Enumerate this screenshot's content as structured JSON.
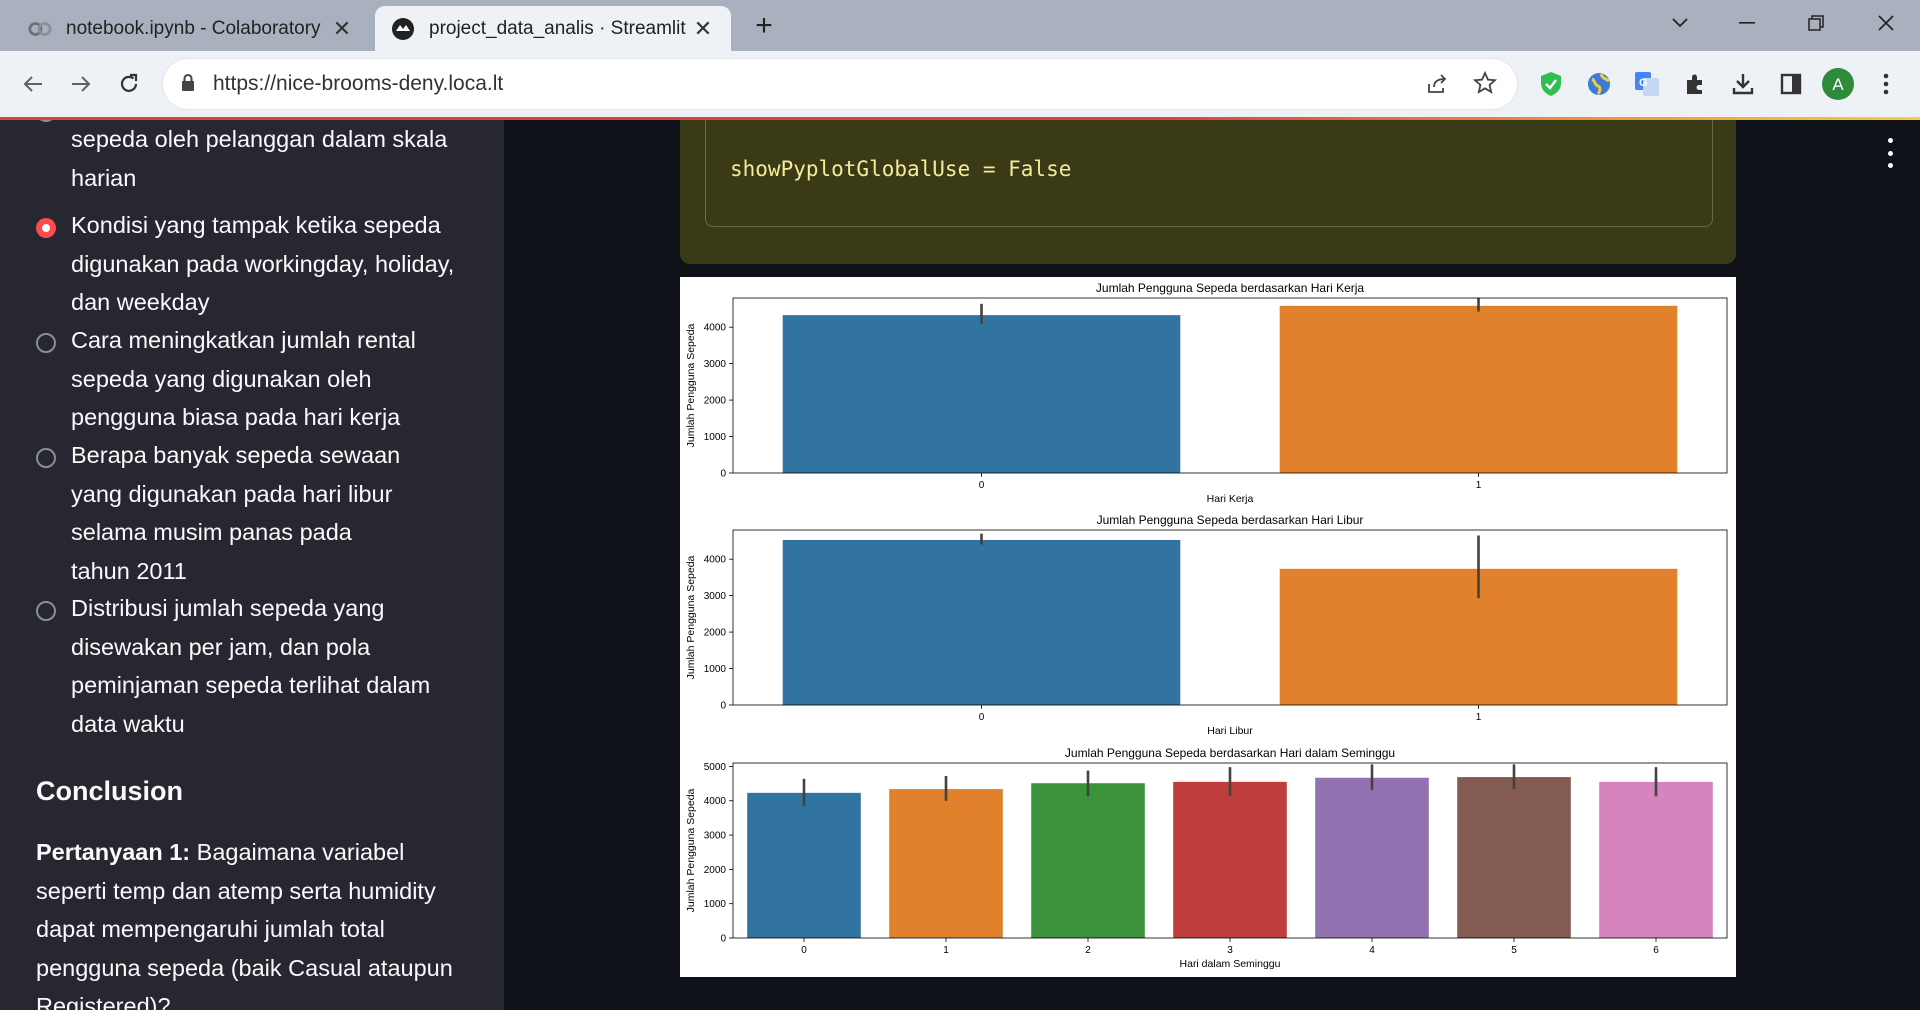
{
  "browser": {
    "tabs": [
      {
        "title": "notebook.ipynb - Colaboratory",
        "active": false,
        "icon": "colab-icon"
      },
      {
        "title": "project_data_analis · Streamlit",
        "active": true,
        "icon": "streamlit-icon"
      }
    ],
    "url": "https://nice-brooms-deny.loca.lt",
    "profile_initial": "A",
    "colors": {
      "accent": "#ff4b4b",
      "profile": "#2e8b3a"
    }
  },
  "sidebar": {
    "partial_top_text": "sepeda oleh pelanggan dalam skala harian",
    "radio_options": [
      {
        "label": "Kondisi yang tampak ketika sepeda digunakan pada workingday, holiday, dan weekday",
        "selected": true
      },
      {
        "label": "Cara meningkatkan jumlah rental sepeda yang digunakan oleh pengguna biasa pada hari kerja",
        "selected": false
      },
      {
        "label": "Berapa banyak sepeda sewaan yang digunakan pada hari libur selama musim panas pada tahun 2011",
        "selected": false
      },
      {
        "label": "Distribusi jumlah sepeda yang disewakan per jam, dan pola peminjaman sepeda terlihat dalam data waktu",
        "selected": false
      }
    ],
    "conclusion_heading": "Conclusion",
    "question_label": "Pertanyaan 1:",
    "question_text": "Bagaimana variabel seperti temp dan atemp serta humidity dapat mempengaruhi jumlah total pengguna sepeda (baik Casual ataupun Registered)?"
  },
  "main": {
    "code_text": "showPyplotGlobalUse = False"
  },
  "chart_data": [
    {
      "type": "bar",
      "title": "Jumlah Pengguna Sepeda berdasarkan Hari Kerja",
      "xlabel": "Hari Kerja",
      "ylabel": "Jumlah Pengguna Sepeda",
      "categories": [
        "0",
        "1"
      ],
      "values": [
        4330,
        4585
      ],
      "error_low": [
        4090,
        4430
      ],
      "error_high": [
        4640,
        4800
      ],
      "colors": [
        "#3274a1",
        "#e1812c"
      ],
      "ylim": [
        0,
        4800
      ],
      "yticks": [
        0,
        1000,
        2000,
        3000,
        4000
      ],
      "grid": false
    },
    {
      "type": "bar",
      "title": "Jumlah Pengguna Sepeda berdasarkan Hari Libur",
      "xlabel": "Hari Libur",
      "ylabel": "Jumlah Pengguna Sepeda",
      "categories": [
        "0",
        "1"
      ],
      "values": [
        4527,
        3735
      ],
      "error_low": [
        4400,
        2930
      ],
      "error_high": [
        4700,
        4650
      ],
      "colors": [
        "#3274a1",
        "#e1812c"
      ],
      "ylim": [
        0,
        4800
      ],
      "yticks": [
        0,
        1000,
        2000,
        3000,
        4000
      ],
      "grid": false
    },
    {
      "type": "bar",
      "title": "Jumlah Pengguna Sepeda berdasarkan Hari dalam Seminggu",
      "xlabel": "Hari dalam Seminggu",
      "ylabel": "Jumlah Pengguna Sepeda",
      "categories": [
        "0",
        "1",
        "2",
        "3",
        "4",
        "5",
        "6"
      ],
      "values": [
        4230,
        4340,
        4510,
        4550,
        4670,
        4690,
        4550
      ],
      "error_low": [
        3850,
        4000,
        4130,
        4150,
        4320,
        4340,
        4130
      ],
      "error_high": [
        4640,
        4720,
        4880,
        4980,
        5060,
        5060,
        4980
      ],
      "colors": [
        "#3274a1",
        "#e1812c",
        "#3a923a",
        "#c03d3e",
        "#9372b2",
        "#845b53",
        "#d684bd"
      ],
      "ylim": [
        0,
        5100
      ],
      "yticks": [
        0,
        1000,
        2000,
        3000,
        4000,
        5000
      ],
      "grid": false
    }
  ]
}
